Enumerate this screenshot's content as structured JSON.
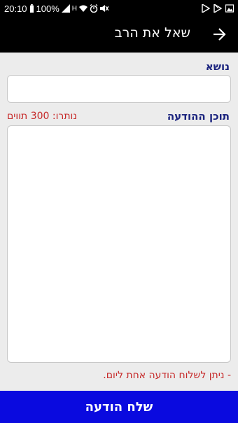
{
  "status_bar": {
    "time": "20:10",
    "battery_percent": "100%",
    "network_letter": "H",
    "icons": [
      "battery-icon",
      "signal-icon",
      "wifi-icon",
      "alarm-icon",
      "mute-icon",
      "play-icon",
      "play-store-icon",
      "image-icon"
    ]
  },
  "header": {
    "title": "שאל את הרב",
    "back_icon": "arrow-right-icon"
  },
  "form": {
    "subject_label": "נושא",
    "subject_value": "",
    "content_label": "תוכן ההודעה",
    "remaining_text": "נותרו: 300 תווים",
    "content_value": "",
    "note": "- ניתן לשלוח הודעה אחת ליום."
  },
  "send_button": {
    "label": "שלח הודעה"
  },
  "colors": {
    "label": "#1a237e",
    "warning": "#c62828",
    "button": "#0a0adf",
    "bar": "#000000"
  }
}
